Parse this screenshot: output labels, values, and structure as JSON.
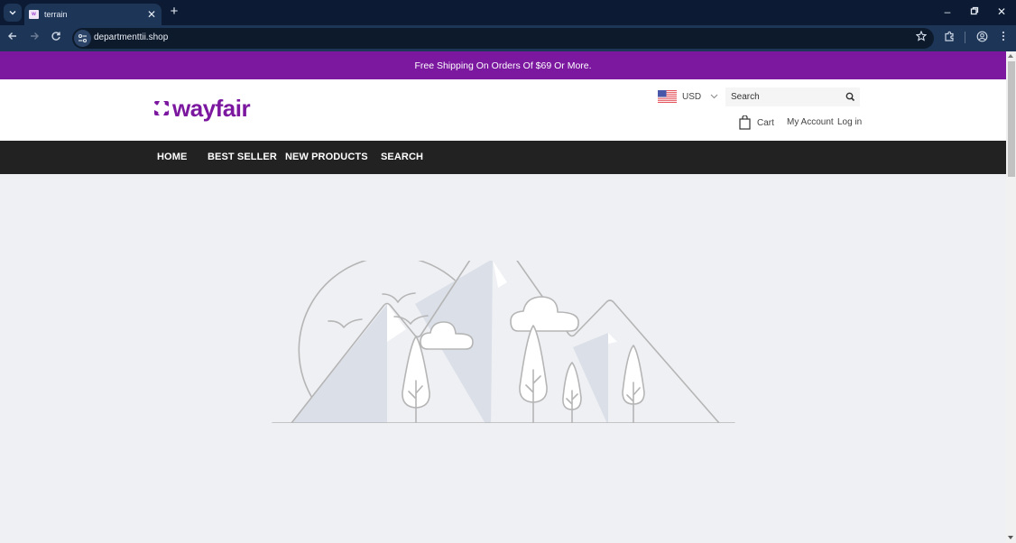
{
  "browser": {
    "tab": {
      "title": "terrain",
      "favicon": "wayfair-favicon"
    },
    "url": "departmenttii.shop",
    "icons": {
      "tab_search": "chevron-down-icon",
      "close_tab": "close-icon",
      "new_tab": "plus-icon",
      "back": "arrow-left-icon",
      "forward": "arrow-right-icon",
      "reload": "reload-icon",
      "site_info": "tune-icon",
      "bookmark": "star-icon",
      "extensions": "puzzle-icon",
      "profile": "account-circle-icon",
      "menu": "kebab-menu-icon",
      "minimize": "minimize-icon",
      "restore": "restore-icon",
      "close_window": "close-icon"
    }
  },
  "promo_bar": {
    "text": "Free Shipping On Orders Of $69 Or More.",
    "background": "#7b189f"
  },
  "header": {
    "logo_text": "wayfair",
    "brand_color": "#7b189f",
    "currency": {
      "selected": "USD",
      "flag": "us-flag-icon"
    },
    "search": {
      "placeholder": "Search",
      "value": ""
    },
    "cart_label": "Cart",
    "my_account_label": "My Account",
    "login_label": "Log in"
  },
  "nav": {
    "items": [
      {
        "label": "HOME"
      },
      {
        "label": "BEST SELLER"
      },
      {
        "label": "NEW PRODUCTS"
      },
      {
        "label": "SEARCH"
      }
    ]
  },
  "hero": {
    "image": "placeholder-landscape-illustration"
  }
}
